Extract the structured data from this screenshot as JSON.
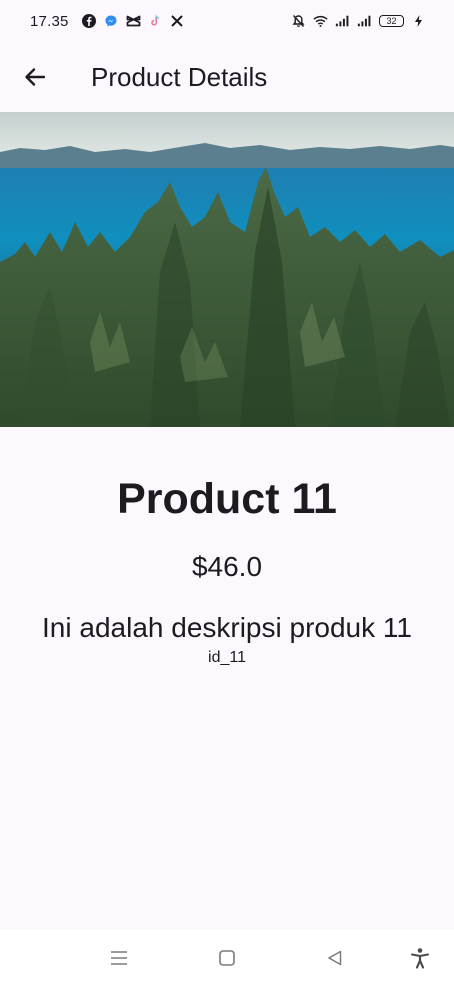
{
  "status_bar": {
    "time": "17.35",
    "battery_level": "32",
    "icons": [
      "facebook-icon",
      "messenger-icon",
      "capcut-icon",
      "tiktok-icon",
      "x-icon",
      "mute-icon",
      "wifi-icon",
      "signal-icon",
      "signal-icon",
      "battery-icon",
      "charging-icon"
    ]
  },
  "app_bar": {
    "title": "Product Details",
    "back_icon": "arrow-left-icon"
  },
  "product": {
    "name": "Product 11",
    "price": "$46.0",
    "description": "Ini adalah deskripsi produk 11",
    "id": "id_11"
  },
  "nav_bar": {
    "icons": [
      "menu-icon",
      "home-icon",
      "back-icon",
      "accessibility-icon"
    ]
  },
  "colors": {
    "background": "#fdf7fe",
    "text": "#1d1b20",
    "nav_icons": "#7a7a7a"
  }
}
